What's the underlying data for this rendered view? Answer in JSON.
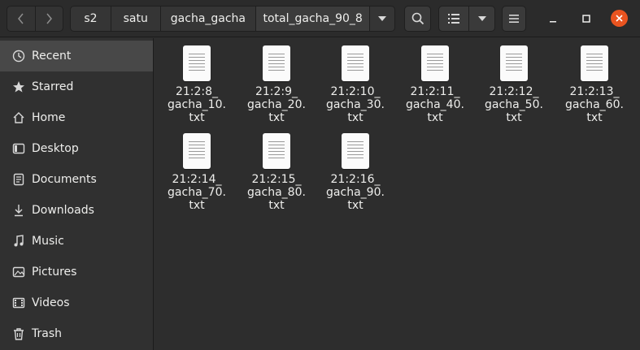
{
  "nav": {
    "back_icon": "chevron-left-icon",
    "forward_icon": "chevron-right-icon"
  },
  "path": {
    "crumbs": [
      "s2",
      "satu",
      "gacha_gacha",
      "total_gacha_90_8"
    ],
    "menu_icon": "triangle-down-icon"
  },
  "toolbar": {
    "search_icon": "search-icon",
    "view_icon": "list-view-icon",
    "view_menu_icon": "triangle-down-icon",
    "menu_icon": "hamburger-icon"
  },
  "window": {
    "minimize_icon": "minimize-icon",
    "maximize_icon": "maximize-icon",
    "close_icon": "close-icon",
    "close_color": "#e95420"
  },
  "sidebar": {
    "items": [
      {
        "label": "Recent",
        "icon": "clock-icon",
        "active": true
      },
      {
        "label": "Starred",
        "icon": "star-icon"
      },
      {
        "label": "Home",
        "icon": "home-icon"
      },
      {
        "label": "Desktop",
        "icon": "desktop-icon"
      },
      {
        "label": "Documents",
        "icon": "documents-icon"
      },
      {
        "label": "Downloads",
        "icon": "downloads-icon"
      },
      {
        "label": "Music",
        "icon": "music-icon"
      },
      {
        "label": "Pictures",
        "icon": "pictures-icon"
      },
      {
        "label": "Videos",
        "icon": "videos-icon"
      },
      {
        "label": "Trash",
        "icon": "trash-icon"
      }
    ]
  },
  "files": [
    {
      "line1": "21:2:8_",
      "line2": "gacha_10.",
      "line3": "txt"
    },
    {
      "line1": "21:2:9_",
      "line2": "gacha_20.",
      "line3": "txt"
    },
    {
      "line1": "21:2:10_",
      "line2": "gacha_30.",
      "line3": "txt"
    },
    {
      "line1": "21:2:11_",
      "line2": "gacha_40.",
      "line3": "txt"
    },
    {
      "line1": "21:2:12_",
      "line2": "gacha_50.",
      "line3": "txt"
    },
    {
      "line1": "21:2:13_",
      "line2": "gacha_60.",
      "line3": "txt"
    },
    {
      "line1": "21:2:14_",
      "line2": "gacha_70.",
      "line3": "txt"
    },
    {
      "line1": "21:2:15_",
      "line2": "gacha_80.",
      "line3": "txt"
    },
    {
      "line1": "21:2:16_",
      "line2": "gacha_90.",
      "line3": "txt"
    }
  ]
}
